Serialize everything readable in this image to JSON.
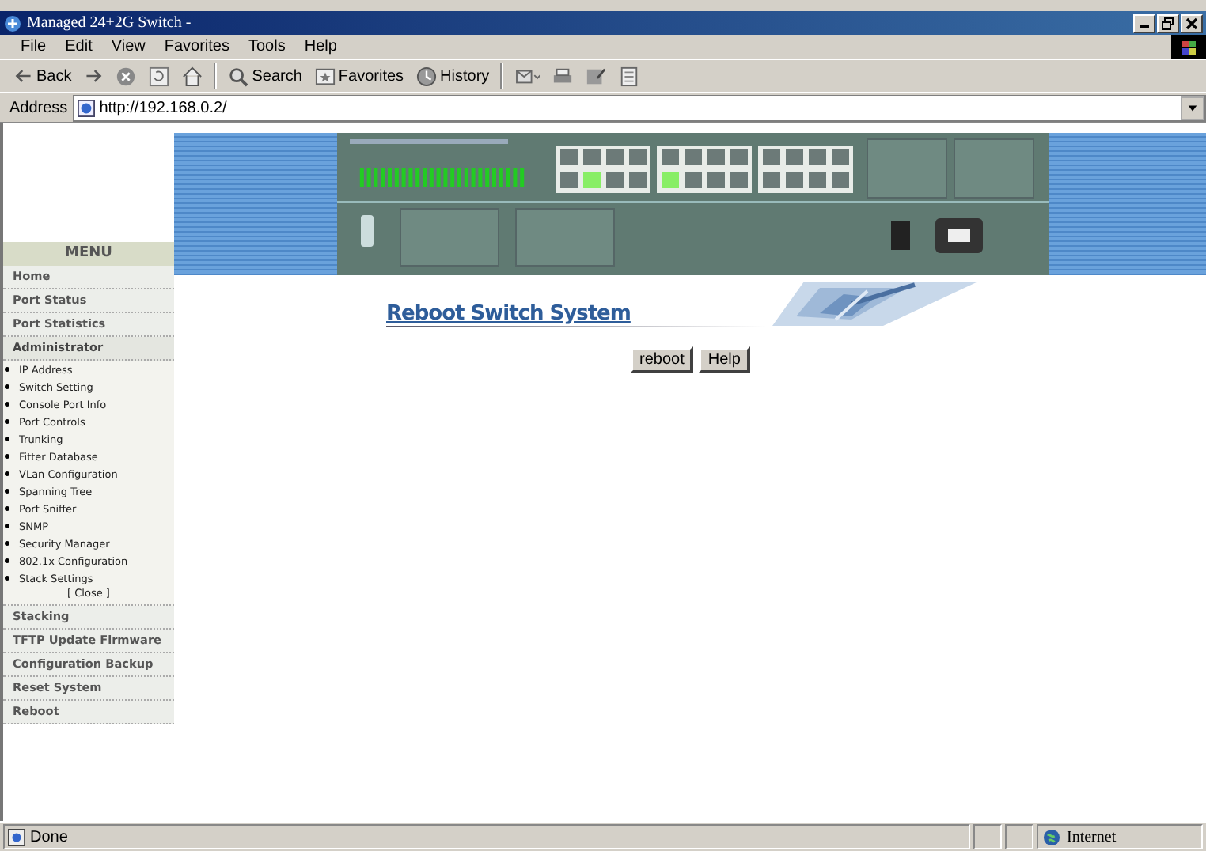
{
  "window": {
    "title": "Managed 24+2G Switch -"
  },
  "menu_bar": [
    "File",
    "Edit",
    "View",
    "Favorites",
    "Tools",
    "Help"
  ],
  "toolbar": [
    {
      "kind": "back",
      "label": "Back"
    },
    {
      "kind": "forward"
    },
    {
      "kind": "stop"
    },
    {
      "kind": "refresh"
    },
    {
      "kind": "home"
    },
    {
      "kind": "search",
      "label": "Search"
    },
    {
      "kind": "favorites",
      "label": "Favorites"
    },
    {
      "kind": "history",
      "label": "History"
    },
    {
      "kind": "mail"
    },
    {
      "kind": "print"
    },
    {
      "kind": "edit"
    },
    {
      "kind": "discuss"
    }
  ],
  "address_bar": {
    "label": "Address",
    "url": "http://192.168.0.2/"
  },
  "sidebar": {
    "title": "MENU",
    "items": [
      {
        "label": "Home"
      },
      {
        "label": "Port Status"
      },
      {
        "label": "Port Statistics"
      },
      {
        "label": "Administrator",
        "expanded": true,
        "close_label": "[ Close ]",
        "children": [
          "IP Address",
          "Switch Setting",
          "Console Port Info",
          "Port Controls",
          "Trunking",
          "Fitter Database",
          "VLan Configuration",
          "Spanning Tree",
          "Port Sniffer",
          "SNMP",
          "Security Manager",
          "802.1x Configuration",
          "Stack Settings"
        ]
      },
      {
        "label": "Stacking"
      },
      {
        "label": "TFTP Update Firmware"
      },
      {
        "label": "Configuration Backup"
      },
      {
        "label": "Reset System"
      },
      {
        "label": "Reboot"
      }
    ]
  },
  "content": {
    "heading": "Reboot Switch System",
    "buttons": [
      "reboot",
      "Help"
    ]
  },
  "status_bar": {
    "text": "Done",
    "zone": "Internet"
  }
}
